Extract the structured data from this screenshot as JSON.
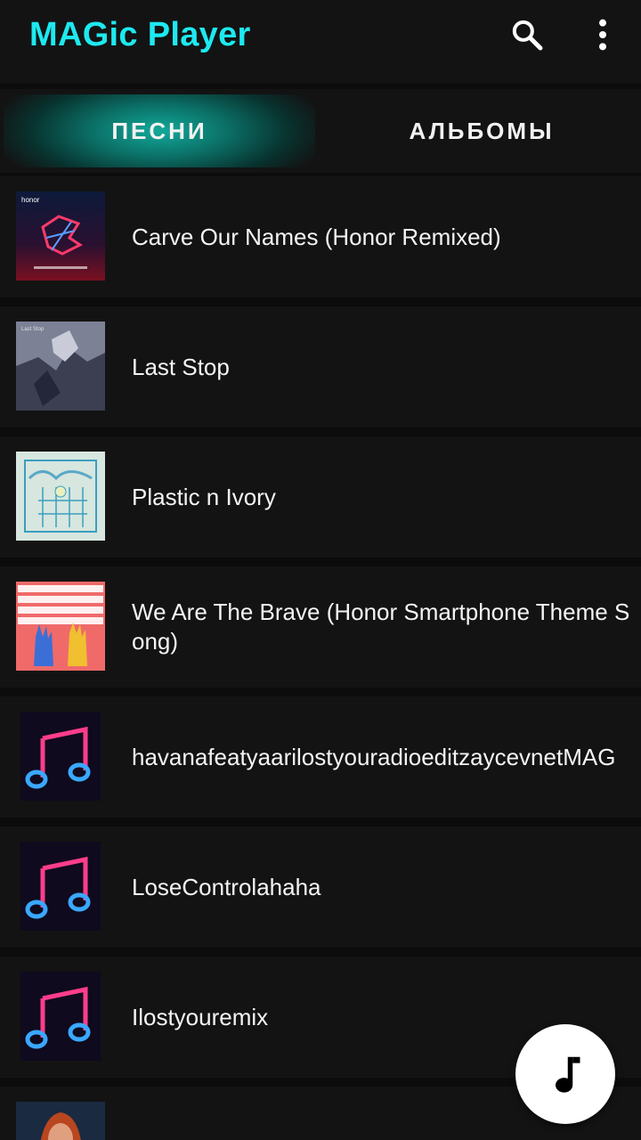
{
  "app": {
    "title": "MAGic Player"
  },
  "tabs": [
    {
      "label": "ПЕСНИ",
      "active": true
    },
    {
      "label": "АЛЬБОМЫ",
      "active": false
    }
  ],
  "songs": [
    {
      "title": "Carve Our Names (Honor Remixed)",
      "cover": "honor-cover"
    },
    {
      "title": "Last Stop",
      "cover": "last-stop-cover"
    },
    {
      "title": "Plastic n Ivory",
      "cover": "plastic-ivory-cover"
    },
    {
      "title": "We Are The Brave (Honor Smartphone Theme Song)",
      "cover": "brave-cover"
    },
    {
      "title": "havanafeatyaarilostyouradioeditzaycevnetMAG",
      "cover": "neon-note-cover"
    },
    {
      "title": "LoseControlahaha",
      "cover": "neon-note-cover"
    },
    {
      "title": "Ilostyouremix",
      "cover": "neon-note-cover"
    },
    {
      "title": "",
      "cover": "portrait-cover"
    }
  ],
  "icons": {
    "search": "search-icon",
    "menu": "more-vert-icon",
    "fab": "music-note-icon"
  },
  "colors": {
    "accent": "#1de9f0",
    "tab_active": "#12a99a",
    "background": "#131313"
  }
}
